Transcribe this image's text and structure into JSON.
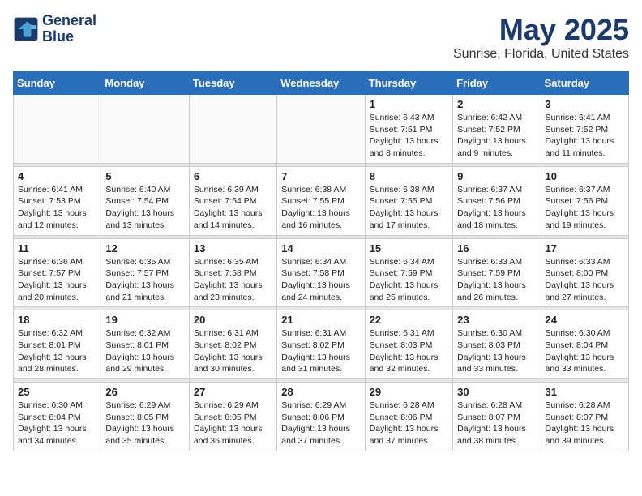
{
  "header": {
    "logo_line1": "General",
    "logo_line2": "Blue",
    "title": "May 2025",
    "subtitle": "Sunrise, Florida, United States"
  },
  "weekdays": [
    "Sunday",
    "Monday",
    "Tuesday",
    "Wednesday",
    "Thursday",
    "Friday",
    "Saturday"
  ],
  "weeks": [
    [
      {
        "day": "",
        "info": ""
      },
      {
        "day": "",
        "info": ""
      },
      {
        "day": "",
        "info": ""
      },
      {
        "day": "",
        "info": ""
      },
      {
        "day": "1",
        "info": "Sunrise: 6:43 AM\nSunset: 7:51 PM\nDaylight: 13 hours\nand 8 minutes."
      },
      {
        "day": "2",
        "info": "Sunrise: 6:42 AM\nSunset: 7:52 PM\nDaylight: 13 hours\nand 9 minutes."
      },
      {
        "day": "3",
        "info": "Sunrise: 6:41 AM\nSunset: 7:52 PM\nDaylight: 13 hours\nand 11 minutes."
      }
    ],
    [
      {
        "day": "4",
        "info": "Sunrise: 6:41 AM\nSunset: 7:53 PM\nDaylight: 13 hours\nand 12 minutes."
      },
      {
        "day": "5",
        "info": "Sunrise: 6:40 AM\nSunset: 7:54 PM\nDaylight: 13 hours\nand 13 minutes."
      },
      {
        "day": "6",
        "info": "Sunrise: 6:39 AM\nSunset: 7:54 PM\nDaylight: 13 hours\nand 14 minutes."
      },
      {
        "day": "7",
        "info": "Sunrise: 6:38 AM\nSunset: 7:55 PM\nDaylight: 13 hours\nand 16 minutes."
      },
      {
        "day": "8",
        "info": "Sunrise: 6:38 AM\nSunset: 7:55 PM\nDaylight: 13 hours\nand 17 minutes."
      },
      {
        "day": "9",
        "info": "Sunrise: 6:37 AM\nSunset: 7:56 PM\nDaylight: 13 hours\nand 18 minutes."
      },
      {
        "day": "10",
        "info": "Sunrise: 6:37 AM\nSunset: 7:56 PM\nDaylight: 13 hours\nand 19 minutes."
      }
    ],
    [
      {
        "day": "11",
        "info": "Sunrise: 6:36 AM\nSunset: 7:57 PM\nDaylight: 13 hours\nand 20 minutes."
      },
      {
        "day": "12",
        "info": "Sunrise: 6:35 AM\nSunset: 7:57 PM\nDaylight: 13 hours\nand 21 minutes."
      },
      {
        "day": "13",
        "info": "Sunrise: 6:35 AM\nSunset: 7:58 PM\nDaylight: 13 hours\nand 23 minutes."
      },
      {
        "day": "14",
        "info": "Sunrise: 6:34 AM\nSunset: 7:58 PM\nDaylight: 13 hours\nand 24 minutes."
      },
      {
        "day": "15",
        "info": "Sunrise: 6:34 AM\nSunset: 7:59 PM\nDaylight: 13 hours\nand 25 minutes."
      },
      {
        "day": "16",
        "info": "Sunrise: 6:33 AM\nSunset: 7:59 PM\nDaylight: 13 hours\nand 26 minutes."
      },
      {
        "day": "17",
        "info": "Sunrise: 6:33 AM\nSunset: 8:00 PM\nDaylight: 13 hours\nand 27 minutes."
      }
    ],
    [
      {
        "day": "18",
        "info": "Sunrise: 6:32 AM\nSunset: 8:01 PM\nDaylight: 13 hours\nand 28 minutes."
      },
      {
        "day": "19",
        "info": "Sunrise: 6:32 AM\nSunset: 8:01 PM\nDaylight: 13 hours\nand 29 minutes."
      },
      {
        "day": "20",
        "info": "Sunrise: 6:31 AM\nSunset: 8:02 PM\nDaylight: 13 hours\nand 30 minutes."
      },
      {
        "day": "21",
        "info": "Sunrise: 6:31 AM\nSunset: 8:02 PM\nDaylight: 13 hours\nand 31 minutes."
      },
      {
        "day": "22",
        "info": "Sunrise: 6:31 AM\nSunset: 8:03 PM\nDaylight: 13 hours\nand 32 minutes."
      },
      {
        "day": "23",
        "info": "Sunrise: 6:30 AM\nSunset: 8:03 PM\nDaylight: 13 hours\nand 33 minutes."
      },
      {
        "day": "24",
        "info": "Sunrise: 6:30 AM\nSunset: 8:04 PM\nDaylight: 13 hours\nand 33 minutes."
      }
    ],
    [
      {
        "day": "25",
        "info": "Sunrise: 6:30 AM\nSunset: 8:04 PM\nDaylight: 13 hours\nand 34 minutes."
      },
      {
        "day": "26",
        "info": "Sunrise: 6:29 AM\nSunset: 8:05 PM\nDaylight: 13 hours\nand 35 minutes."
      },
      {
        "day": "27",
        "info": "Sunrise: 6:29 AM\nSunset: 8:05 PM\nDaylight: 13 hours\nand 36 minutes."
      },
      {
        "day": "28",
        "info": "Sunrise: 6:29 AM\nSunset: 8:06 PM\nDaylight: 13 hours\nand 37 minutes."
      },
      {
        "day": "29",
        "info": "Sunrise: 6:28 AM\nSunset: 8:06 PM\nDaylight: 13 hours\nand 37 minutes."
      },
      {
        "day": "30",
        "info": "Sunrise: 6:28 AM\nSunset: 8:07 PM\nDaylight: 13 hours\nand 38 minutes."
      },
      {
        "day": "31",
        "info": "Sunrise: 6:28 AM\nSunset: 8:07 PM\nDaylight: 13 hours\nand 39 minutes."
      }
    ]
  ]
}
